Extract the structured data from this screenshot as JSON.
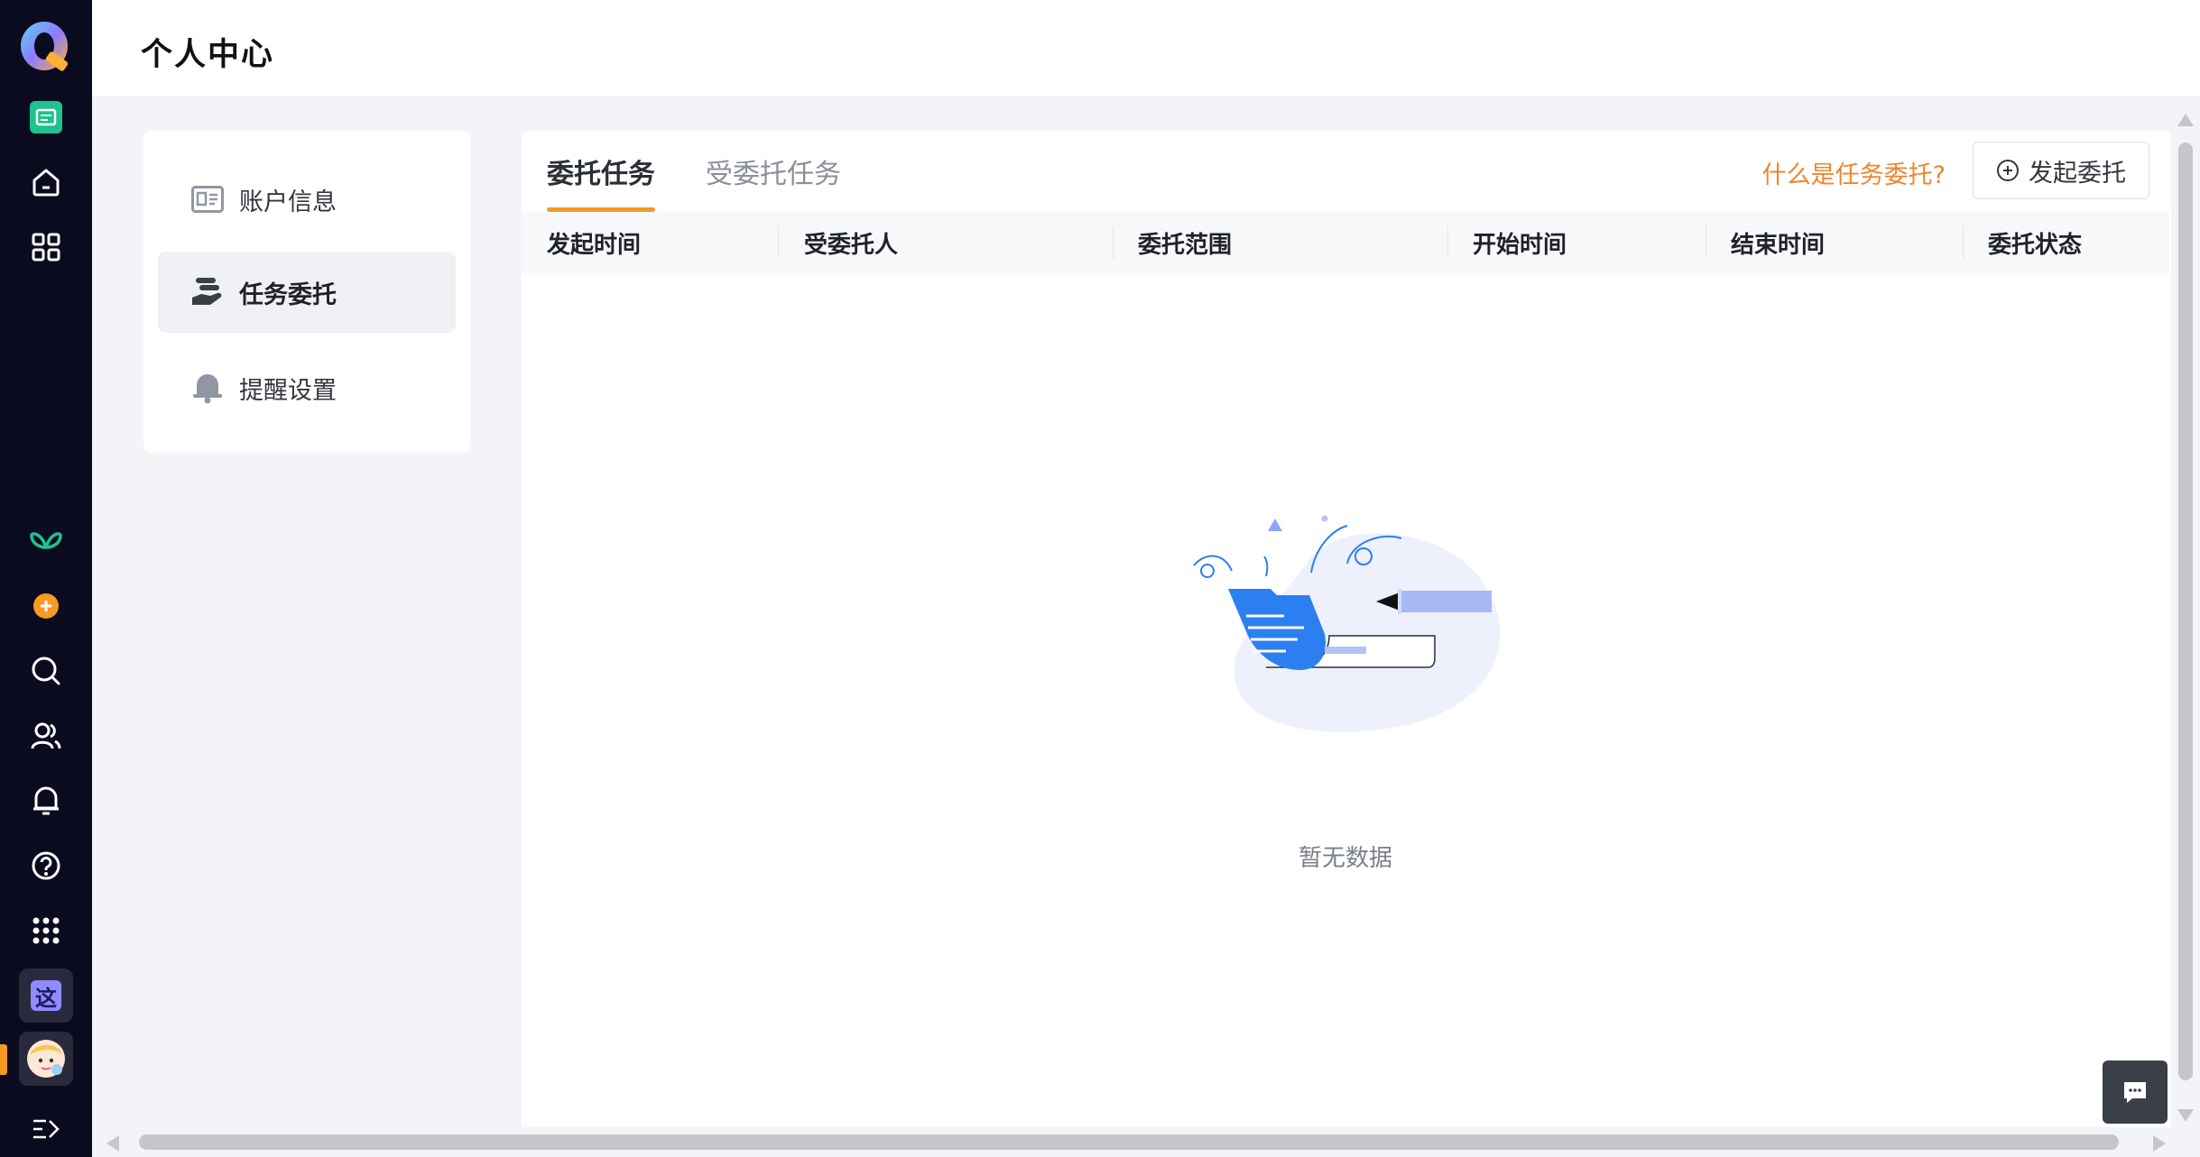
{
  "header": {
    "title": "个人中心"
  },
  "rail": {
    "items": [
      {
        "icon": "calendar-card-icon"
      },
      {
        "icon": "home-icon"
      },
      {
        "icon": "apps-grid-icon"
      },
      {
        "icon": "butterfly-icon"
      },
      {
        "icon": "add-circle-icon"
      },
      {
        "icon": "search-icon"
      },
      {
        "icon": "contacts-icon"
      },
      {
        "icon": "bell-icon"
      },
      {
        "icon": "help-icon"
      },
      {
        "icon": "dots-grid-icon"
      }
    ],
    "badge_text": "这",
    "colors": {
      "background": "#0b0b1f",
      "accent": "#f59a23",
      "green": "#1ec28b"
    }
  },
  "side_menu": {
    "items": [
      {
        "label": "账户信息",
        "icon": "id-card-icon",
        "active": false
      },
      {
        "label": "任务委托",
        "icon": "delegate-hand-icon",
        "active": true
      },
      {
        "label": "提醒设置",
        "icon": "bell-icon",
        "active": false
      }
    ]
  },
  "panel": {
    "tabs": [
      {
        "label": "委托任务",
        "active": true
      },
      {
        "label": "受委托任务",
        "active": false
      }
    ],
    "help_link": "什么是任务委托?",
    "launch_button": "发起委托",
    "columns": [
      "发起时间",
      "受委托人",
      "委托范围",
      "开始时间",
      "结束时间",
      "委托状态"
    ],
    "rows": [],
    "empty_text": "暂无数据"
  },
  "theme": {
    "accent": "#f59a23",
    "link": "#f0852d",
    "primary_blue": "#2b7ff0"
  }
}
